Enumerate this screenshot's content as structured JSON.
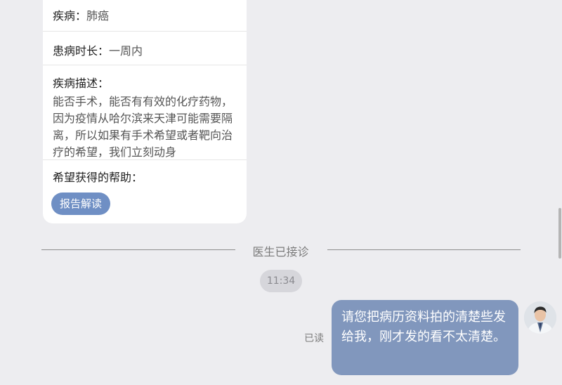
{
  "card": {
    "disease_label": "疾病：",
    "disease_value": "肺癌",
    "duration_label": "患病时长：",
    "duration_value": "一周内",
    "description_label": "疾病描述：",
    "description_text": "能否手术，能否有有效的化疗药物，因为疫情从哈尔滨来天津可能需要隔离，所以如果有手术希望或者靶向治疗的希望，我们立刻动身",
    "help_label": "希望获得的帮助：",
    "help_tag": "报告解读"
  },
  "system_notice": "医生已接诊",
  "timestamp": "11:34",
  "message": {
    "read_status": "已读",
    "text": "请您把病历资料拍的清楚些发给我，刚才发的看不太清楚。"
  },
  "colors": {
    "background": "#ededf0",
    "bubble": "#8197bd",
    "tag": "#6f8fc4"
  }
}
